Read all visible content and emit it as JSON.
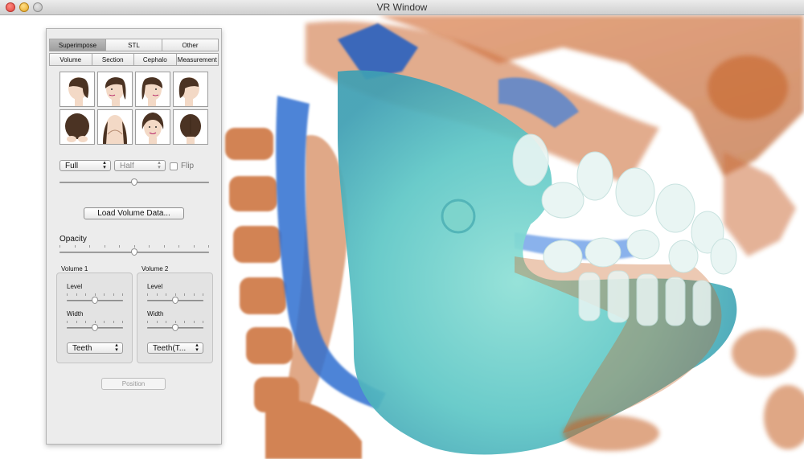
{
  "window": {
    "title": "VR Window"
  },
  "tabs_row1": [
    "Superimpose",
    "STL",
    "Other"
  ],
  "tabs_row2": [
    "Volume",
    "Section",
    "Cephalo",
    "Measurement"
  ],
  "face_views": [
    "left-profile-icon",
    "left-oblique-icon",
    "right-oblique-icon",
    "right-profile-icon",
    "top-view-icon",
    "bottom-view-icon",
    "front-view-icon",
    "back-view-icon"
  ],
  "view_controls": {
    "mode_value": "Full",
    "side_value": "Half",
    "flip_label": "Flip",
    "flip_checked": false,
    "clip_slider": 0.5
  },
  "load_button": "Load Volume Data...",
  "opacity": {
    "label": "Opacity",
    "value": 0.5
  },
  "volume1": {
    "title": "Volume 1",
    "level_label": "Level",
    "level": 0.5,
    "width_label": "Width",
    "width": 0.5,
    "preset": "Teeth"
  },
  "volume2": {
    "title": "Volume 2",
    "level_label": "Level",
    "level": 0.5,
    "width_label": "Width",
    "width": 0.5,
    "preset": "Teeth(T..."
  },
  "position_button": "Position",
  "colors": {
    "bone": "#c9601f",
    "soft": "#5fc7c6",
    "teeth": "#eaf4f2",
    "airway": "#2f6fd0"
  }
}
